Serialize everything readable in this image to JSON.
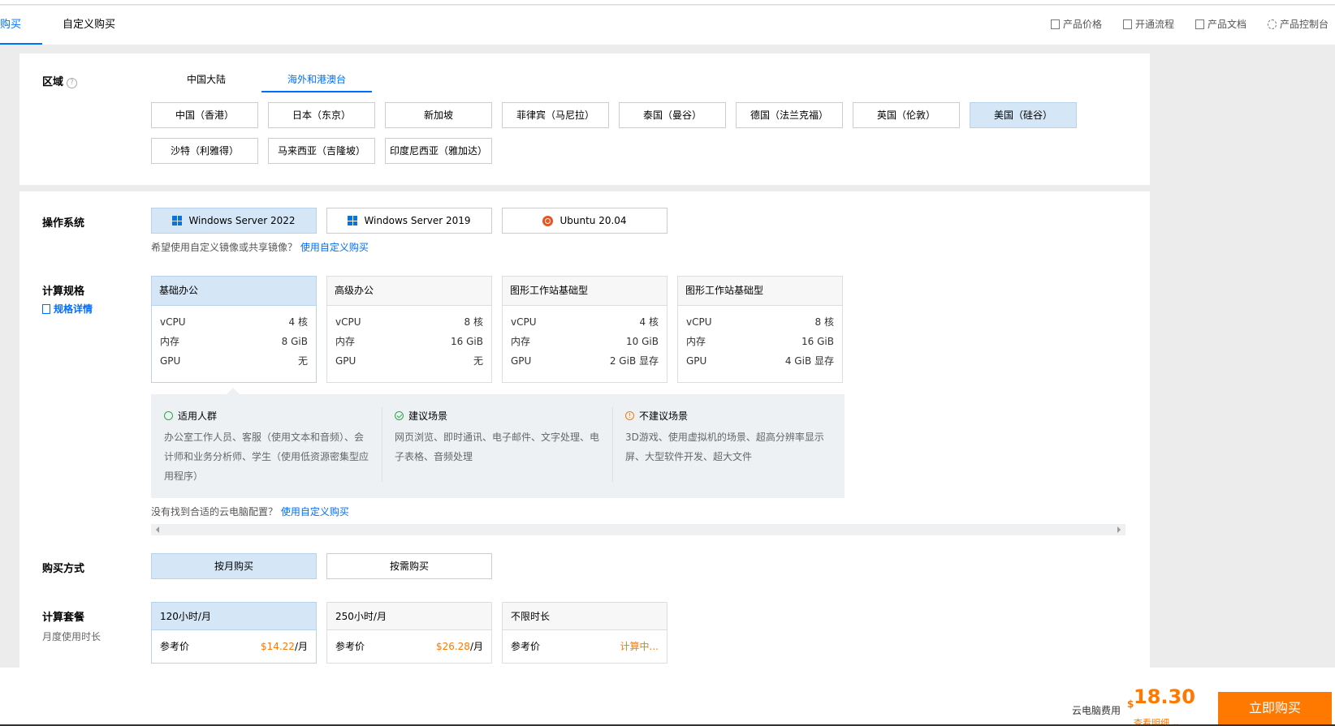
{
  "tabs": {
    "current": "购买",
    "custom": "自定义购买"
  },
  "top_links": [
    {
      "label": "产品价格",
      "icon": "list-icon"
    },
    {
      "label": "开通流程",
      "icon": "doc-icon"
    },
    {
      "label": "产品文档",
      "icon": "book-icon"
    },
    {
      "label": "产品控制台",
      "icon": "gear-icon"
    }
  ],
  "region": {
    "label": "区域",
    "tabs": [
      "中国大陆",
      "海外和港澳台"
    ],
    "active_tab": 1,
    "options": [
      "中国（香港）",
      "日本（东京）",
      "新加坡",
      "菲律宾（马尼拉）",
      "泰国（曼谷）",
      "德国（法兰克福）",
      "英国（伦敦）",
      "美国（硅谷）",
      "沙特（利雅得）",
      "马来西亚（吉隆坡）",
      "印度尼西亚（雅加达）"
    ],
    "selected": "美国（硅谷）"
  },
  "os": {
    "label": "操作系统",
    "options": [
      "Windows Server 2022",
      "Windows Server 2019",
      "Ubuntu 20.04"
    ],
    "selected": "Windows Server 2022",
    "hint": "希望使用自定义镜像或共享镜像？",
    "hint_link": "使用自定义购买"
  },
  "spec": {
    "label": "计算规格",
    "detail_link": "规格详情",
    "cards": [
      {
        "name": "基础办公",
        "vcpu": "4 核",
        "mem": "8 GiB",
        "gpu": "无"
      },
      {
        "name": "高级办公",
        "vcpu": "8 核",
        "mem": "16 GiB",
        "gpu": "无"
      },
      {
        "name": "图形工作站基础型",
        "vcpu": "4 核",
        "mem": "10 GiB",
        "gpu": "2 GiB 显存"
      },
      {
        "name": "图形工作站基础型",
        "vcpu": "8 核",
        "mem": "16 GiB",
        "gpu": "4 GiB 显存"
      }
    ],
    "row_labels": {
      "vcpu": "vCPU",
      "mem": "内存",
      "gpu": "GPU"
    },
    "info": {
      "users_title": "适用人群",
      "users_text": "办公室工作人员、客服（使用文本和音频）、会计师和业务分析师、学生（使用低资源密集型应用程序）",
      "scenes_title": "建议场景",
      "scenes_text": "网页浏览、即时通讯、电子邮件、文字处理、电子表格、音频处理",
      "not_title": "不建议场景",
      "not_text": "3D游戏、使用虚拟机的场景、超高分辨率显示屏、大型软件开发、超大文件"
    },
    "hint": "没有找到合适的云电脑配置？",
    "hint_link": "使用自定义购买"
  },
  "purchase": {
    "label": "购买方式",
    "options": [
      "按月购买",
      "按需购买"
    ],
    "selected": "按月购买"
  },
  "package": {
    "label": "计算套餐",
    "sublabel": "月度使用时长",
    "price_label": "参考价",
    "cards": [
      {
        "name": "120小时/月",
        "price": "$14.22",
        "unit": "/月"
      },
      {
        "name": "250小时/月",
        "price": "$26.28",
        "unit": "/月"
      },
      {
        "name": "不限时长",
        "price": "计算中...",
        "unit": ""
      }
    ]
  },
  "footer": {
    "fee_label": "云电脑费用",
    "currency": "$",
    "amount": "18.30",
    "detail": "查看明细",
    "buy_button": "立即购买"
  },
  "colors": {
    "accent": "#006eff",
    "selected_bg": "#d5e7f7",
    "price": "#ff7800"
  }
}
